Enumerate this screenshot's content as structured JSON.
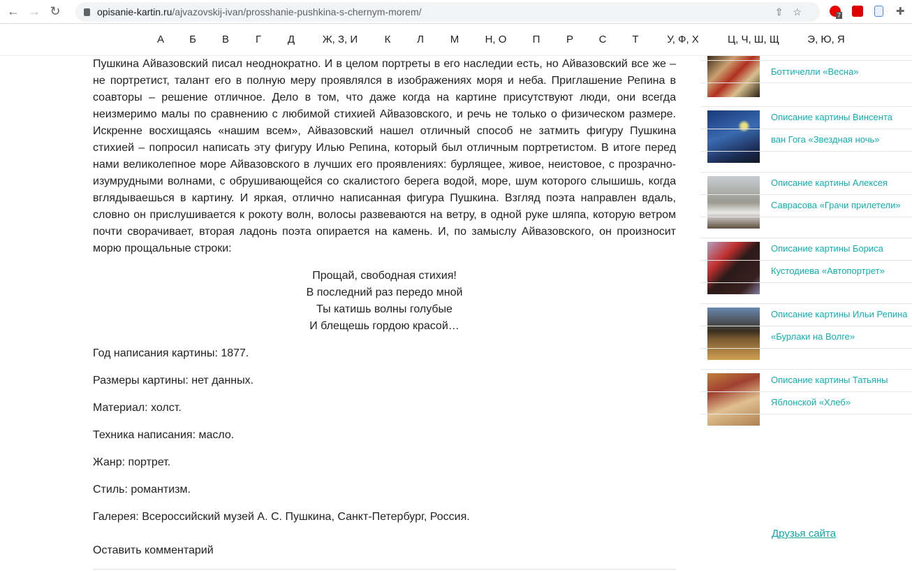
{
  "browser": {
    "url_domain": "opisanie-kartin.ru",
    "url_path": "/ajvazovskij-ivan/prosshanie-pushkina-s-chernym-morem/",
    "ext_badge": "7"
  },
  "alphabet": [
    "А",
    "Б",
    "В",
    "Г",
    "Д",
    "Ж, З, И",
    "К",
    "Л",
    "М",
    "Н, О",
    "П",
    "Р",
    "С",
    "Т",
    "У, Ф, Х",
    "Ц, Ч, Ш, Щ",
    "Э, Ю, Я"
  ],
  "article": {
    "lines": [
      "Пушкина Айвазовский писал неоднократно. И в целом портреты в его наследии есть, но Айвазовский все же –",
      "не портретист, талант его в полную меру проявлялся в изображениях моря и неба. Приглашение Репина в",
      "соавторы – решение отличное. Дело в том, что даже когда на картине присутствуют люди, они всегда",
      "неизмеримо малы по сравнению с любимой стихией Айвазовского, и речь не только о физическом размере.",
      "Искренне восхищаясь «нашим всем», Айвазовский нашел отличный способ не затмить фигуру Пушкина",
      "стихией – попросил написать эту фигуру Илью Репина, который был отличным портретистом. В итоге перед",
      "нами великолепное море Айвазовского в лучших его проявлениях: бурлящее, живое, неистовое, с прозрачно-",
      "изумрудными волнами, с обрушивающейся со скалистого берега водой, море, шум которого слышишь, когда",
      "вглядываешься в картину. И яркая, отлично написанная фигура Пушкина. Взгляд поэта направлен вдаль,",
      "словно он прислушивается к рокоту волн, волосы развеваются на ветру, в одной руке шляпа, которую ветром",
      "почти сворачивает, вторая ладонь поэта опирается на камень. И, по замыслу Айвазовского, он произносит",
      "морю прощальные строки:"
    ],
    "poem": [
      "Прощай, свободная стихия!",
      "В последний раз передо мной",
      "Ты катишь волны голубые",
      "И блещешь гордою красой…"
    ],
    "meta": [
      "Год написания картины: 1877.",
      "Размеры картины: нет данных.",
      "Материал: холст.",
      "Техника написания: масло.",
      "Жанр: портрет.",
      "Стиль: романтизм.",
      "Галерея: Всероссийский музей А. С. Пушкина, Санкт-Петербург, Россия."
    ],
    "comment": "Оставить комментарий"
  },
  "sidebar": [
    {
      "lines": [
        "Боттичелли «Весна»"
      ]
    },
    {
      "lines": [
        "Описание картины Винсента",
        "ван Гога «Звездная ночь»"
      ]
    },
    {
      "lines": [
        "Описание картины Алексея",
        "Саврасова «Грачи прилетели»"
      ]
    },
    {
      "lines": [
        "Описание картины Бориса",
        "Кустодиева «Автопортрет»"
      ]
    },
    {
      "lines": [
        "Описание картины Ильи Репина",
        "«Бурлаки на Волге»"
      ]
    },
    {
      "lines": [
        "Описание картины Татьяны",
        "Яблонской «Хлеб»"
      ]
    }
  ],
  "friends": "Друзья сайта"
}
